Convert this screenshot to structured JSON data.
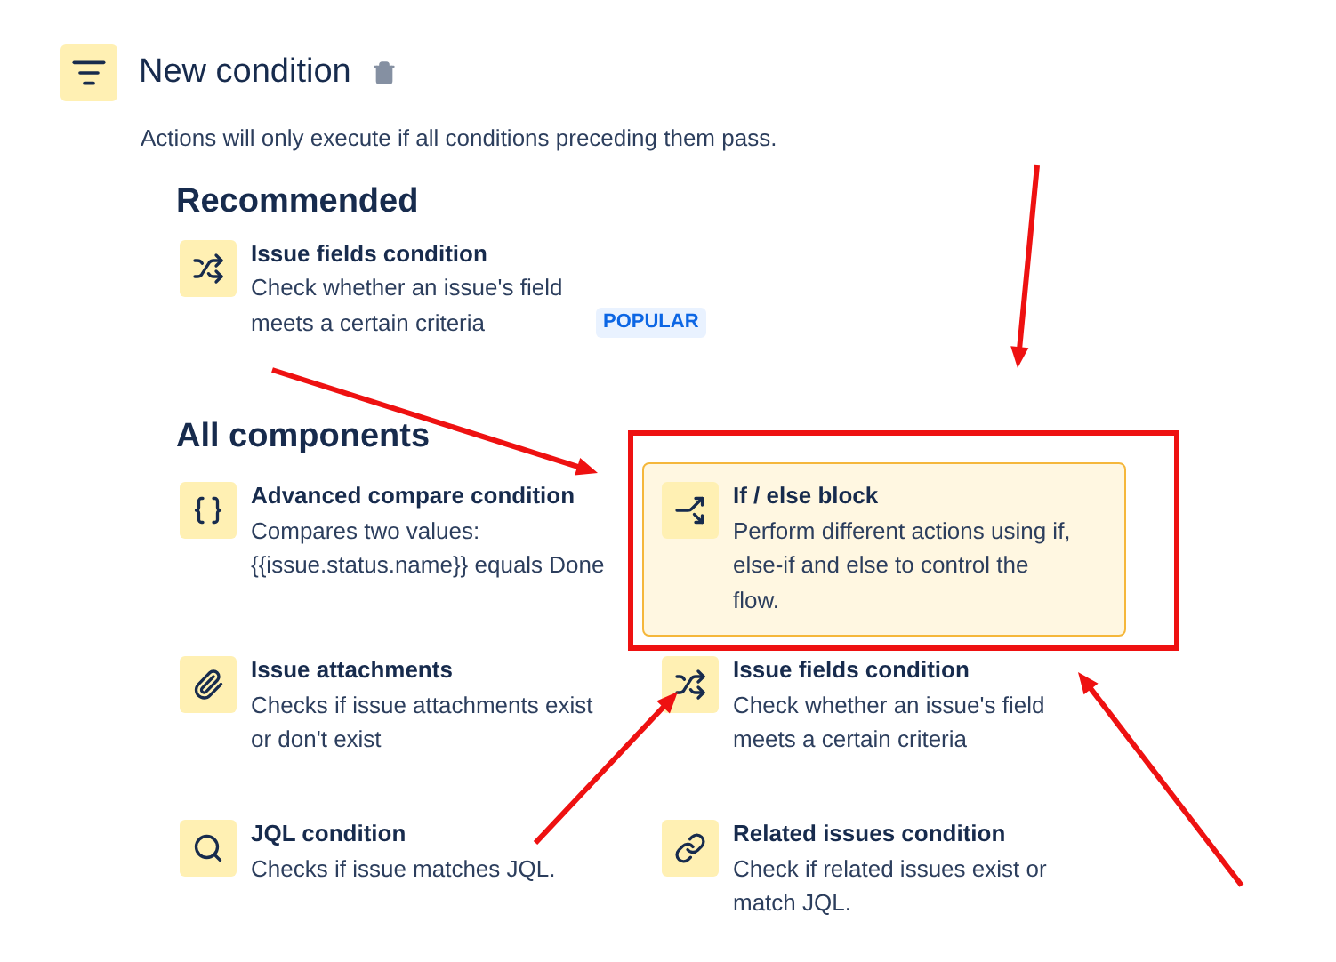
{
  "header": {
    "title": "New condition",
    "description": "Actions will only execute if all conditions preceding them pass."
  },
  "sections": [
    {
      "title": "Recommended",
      "items": [
        {
          "kind": "shuffle",
          "title": "Issue fields condition",
          "description": "Check whether an issue's field meets a certain criteria",
          "badge": "POPULAR",
          "selected": false
        }
      ]
    },
    {
      "title": "All components",
      "items": [
        {
          "kind": "braces",
          "title": "Advanced compare condition",
          "description": "Compares two values: {{issue.status.name}} equals Done",
          "selected": false
        },
        {
          "kind": "split",
          "title": "If / else block",
          "description": "Perform different actions using if, else-if and else to control the flow.",
          "selected": true
        },
        {
          "kind": "paperclip",
          "title": "Issue attachments",
          "description": "Checks if issue attachments exist or don't exist",
          "selected": false
        },
        {
          "kind": "shuffle",
          "title": "Issue fields condition",
          "description": "Check whether an issue's field meets a certain criteria",
          "selected": false
        },
        {
          "kind": "search",
          "title": "JQL condition",
          "description": "Checks if issue matches JQL.",
          "selected": false
        },
        {
          "kind": "link",
          "title": "Related issues condition",
          "description": "Check if related issues exist or match JQL.",
          "selected": false
        }
      ]
    }
  ]
}
